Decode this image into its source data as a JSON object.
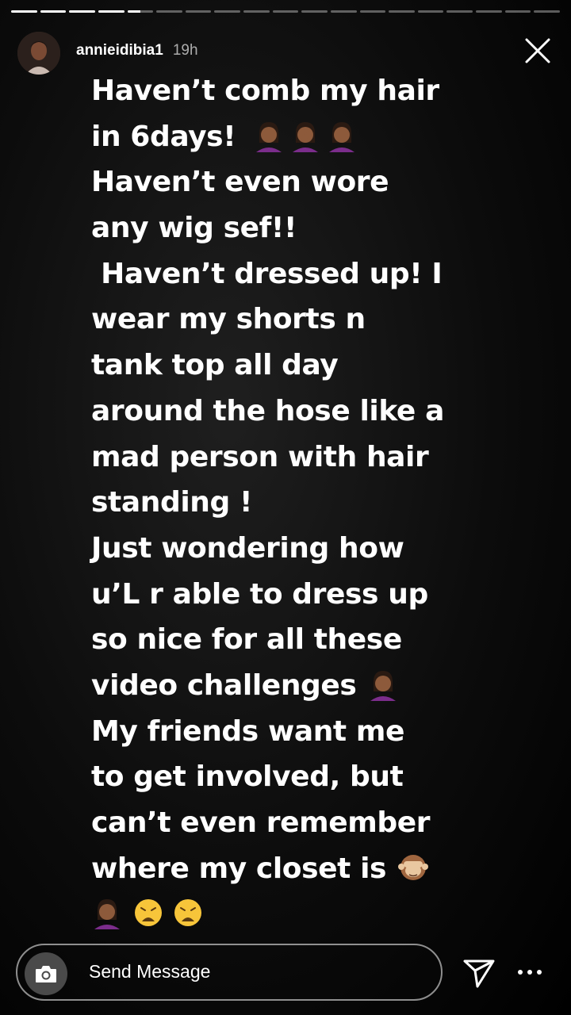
{
  "progress": {
    "total_segments": 19,
    "completed_segments": 4,
    "current_fraction": 0.5
  },
  "header": {
    "username": "annieidibia1",
    "time": "19h"
  },
  "icons": {
    "close": "close-icon",
    "camera": "camera-icon",
    "send": "send-icon",
    "more": "more-icon",
    "facepalm": "woman-facepalming-emoji",
    "see_no_evil": "see-no-evil-monkey-emoji",
    "weary": "weary-face-emoji"
  },
  "story": {
    "lines": [
      "Haven’t comb my hair",
      "in 6days!",
      "Haven’t even wore",
      "any wig sef!!",
      " Haven’t dressed up! I",
      "wear my shorts n",
      "tank top all day",
      "around the hose like a",
      "mad person with hair",
      "standing !",
      "Just wondering how",
      "u’L r able to dress up",
      "so nice for all these",
      "video challenges",
      "My friends want me",
      "to get involved, but",
      "can’t even remember",
      "where my closet is",
      ""
    ]
  },
  "composer": {
    "placeholder": "Send Message"
  },
  "colors": {
    "background": "#0c0c0c",
    "text": "#ffffff",
    "camera_bg": "#4a4a4a"
  }
}
